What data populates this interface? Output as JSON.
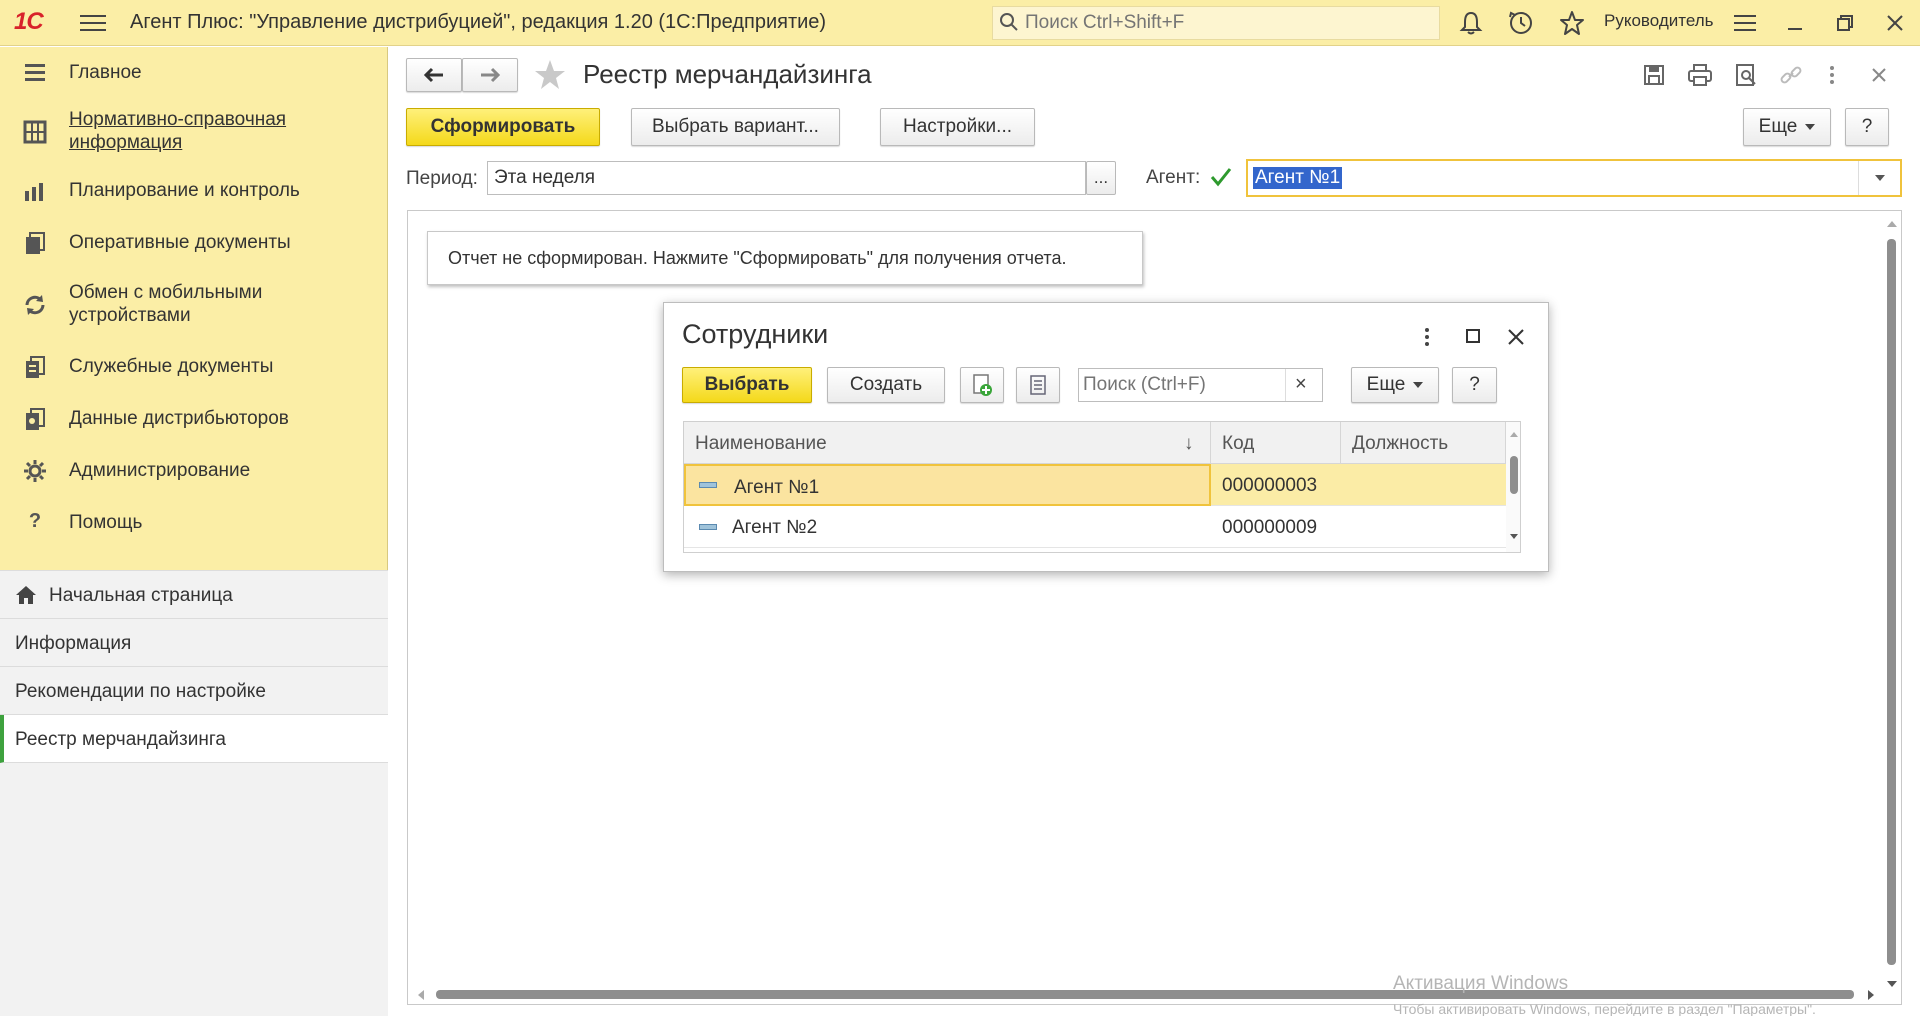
{
  "app": {
    "logo": "1С",
    "title": "Агент Плюс: \"Управление дистрибуцией\", редакция 1.20  (1С:Предприятие)",
    "search_placeholder": "Поиск Ctrl+Shift+F",
    "user": "Руководитель"
  },
  "sidebar": {
    "items": [
      {
        "label": "Главное",
        "icon": "menu-lines-icon"
      },
      {
        "label": "Нормативно-справочная информация",
        "icon": "grid-icon"
      },
      {
        "label": "Планирование и контроль",
        "icon": "bar-chart-icon"
      },
      {
        "label": "Оперативные документы",
        "icon": "documents-icon"
      },
      {
        "label": "Обмен с мобильными устройствами",
        "icon": "sync-icon"
      },
      {
        "label": "Служебные документы",
        "icon": "service-docs-icon"
      },
      {
        "label": "Данные дистрибьюторов",
        "icon": "distributor-icon"
      },
      {
        "label": "Администрирование",
        "icon": "gear-icon"
      },
      {
        "label": "Помощь",
        "icon": "question-icon"
      }
    ],
    "open_windows": [
      {
        "label": "Начальная страница",
        "icon": "home-icon"
      },
      {
        "label": "Информация"
      },
      {
        "label": "Рекомендации по настройке"
      },
      {
        "label": "Реестр мерчандайзинга"
      }
    ]
  },
  "form": {
    "title": "Реестр мерчандайзинга",
    "generate_label": "Сформировать",
    "choose_variant_label": "Выбрать вариант...",
    "settings_label": "Настройки...",
    "more_label": "Еще",
    "help_label": "?",
    "period_label": "Период:",
    "period_value": "Эта неделя",
    "period_button": "...",
    "agent_label": "Агент:",
    "agent_value": "Агент №1",
    "report_message": "Отчет не сформирован. Нажмите \"Сформировать\" для получения отчета."
  },
  "dialog": {
    "title": "Сотрудники",
    "select_label": "Выбрать",
    "create_label": "Создать",
    "search_placeholder": "Поиск (Ctrl+F)",
    "search_clear": "×",
    "more_label": "Еще",
    "help_label": "?",
    "columns": [
      "Наименование",
      "Код",
      "Должность"
    ],
    "sort_indicator": "↓",
    "rows": [
      {
        "name": "Агент №1",
        "code": "000000003",
        "position": ""
      },
      {
        "name": "Агент №2",
        "code": "000000009",
        "position": ""
      }
    ]
  },
  "watermark": {
    "line1": "Активация Windows",
    "line2": "Чтобы активировать Windows, перейдите в раздел \"Параметры\"."
  },
  "colors": {
    "accent_yellow": "#fbeea6",
    "button_yellow": "#f4d91a",
    "selection": "#fbeca6",
    "active_green": "#3ea23e"
  }
}
